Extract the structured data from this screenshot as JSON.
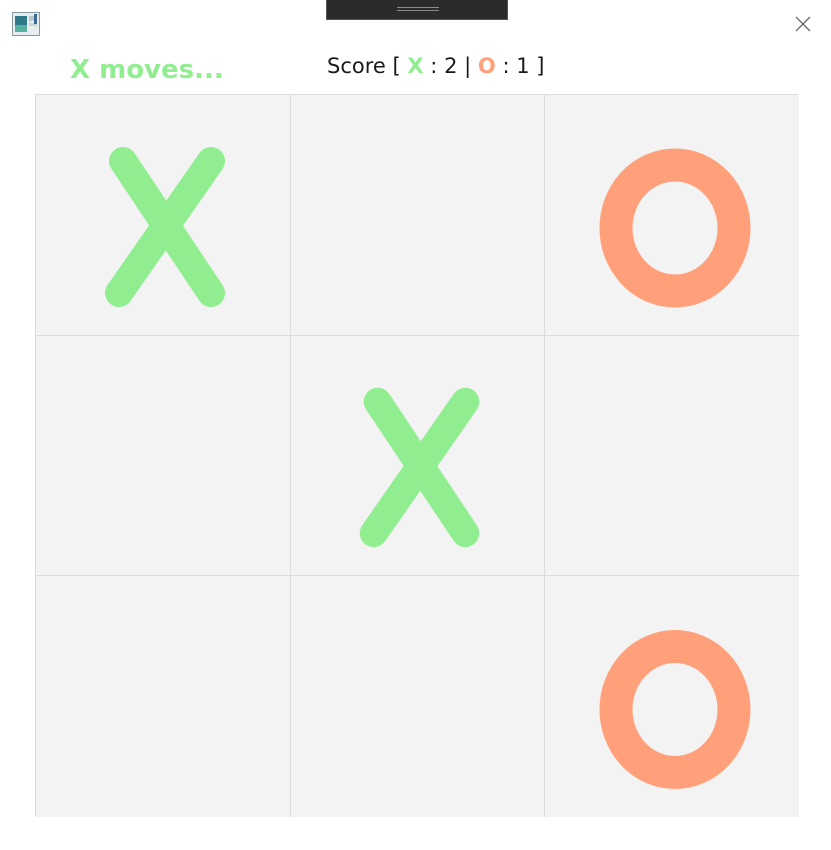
{
  "window": {
    "app_icon": "tic-tac-toe-app-icon",
    "close_icon": "close-icon"
  },
  "status": {
    "turn_text": "X moves...",
    "turn_color": "#90ee90"
  },
  "score": {
    "label": "Score",
    "open_bracket": "[",
    "x_label": "X",
    "separator_x": ":",
    "x_value": "2",
    "divider": "|",
    "o_label": "O",
    "separator_o": ":",
    "o_value": "1",
    "close_bracket": "]"
  },
  "colors": {
    "x": "#90ee90",
    "o": "#ffa07a",
    "cell_bg": "#f3f3f3",
    "grid_line": "#dcdcdc"
  },
  "board": {
    "cells": [
      "X",
      "",
      "O",
      "",
      "X",
      "",
      "",
      "",
      "O"
    ]
  }
}
